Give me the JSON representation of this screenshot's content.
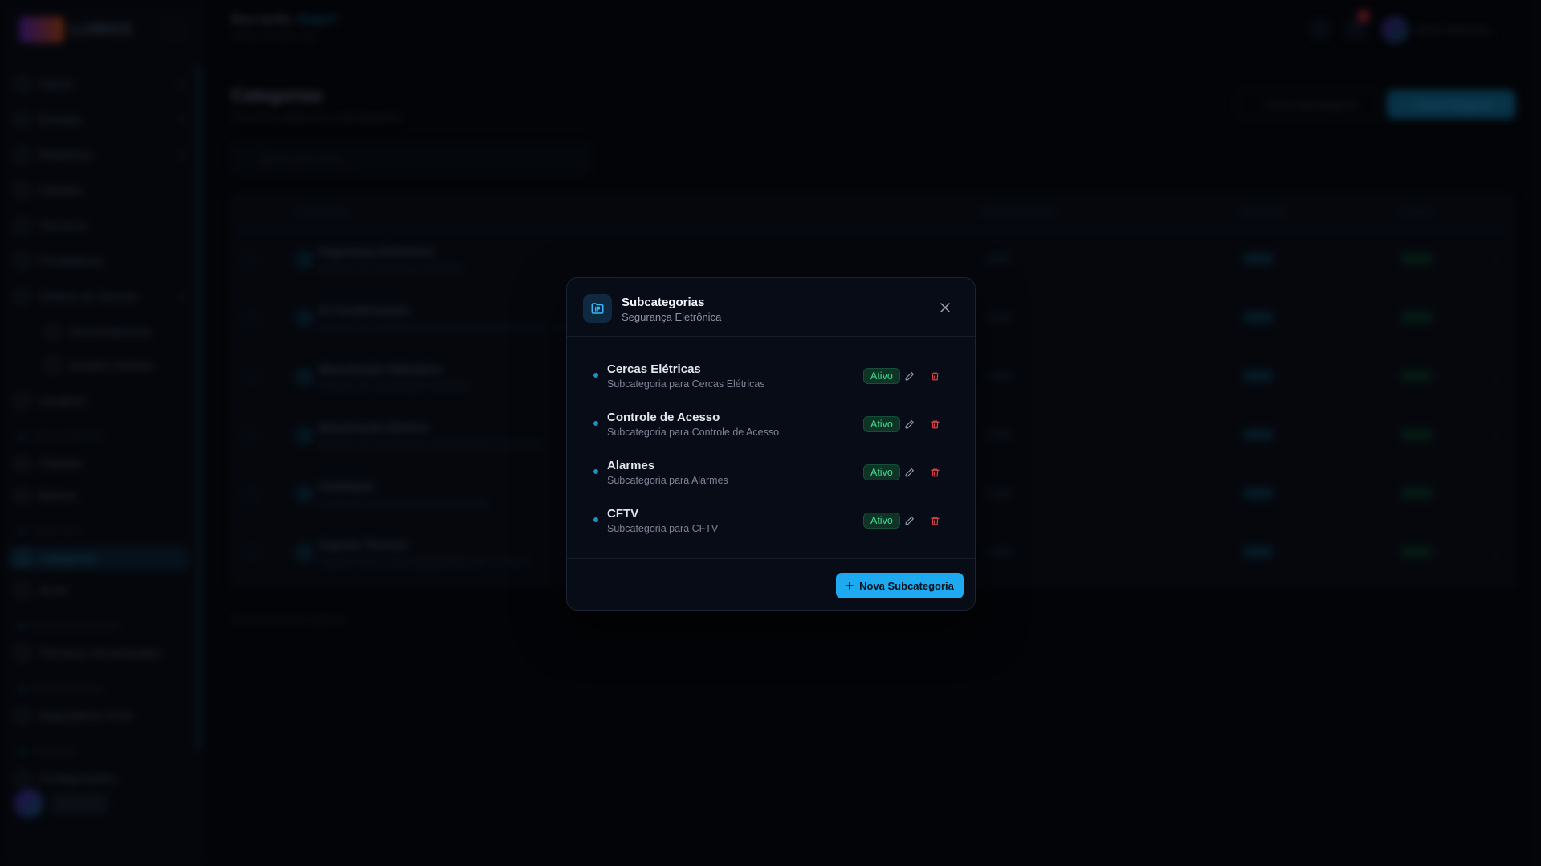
{
  "background": {
    "brand": "LUMOS",
    "greeting": {
      "prefix": "Boa tarde,",
      "name": "Super!",
      "sub": "Tenha um ótimo dia"
    },
    "nav": [
      {
        "label": "Painel",
        "chevron": true
      },
      {
        "label": "Entrada",
        "chevron": true
      },
      {
        "label": "Relatórios",
        "chevron": true
      },
      {
        "label": "Clientes",
        "chevron": false
      },
      {
        "label": "Técnicos",
        "chevron": false
      },
      {
        "label": "Prestadores",
        "chevron": false
      },
      {
        "label": "Ordens de Serviço",
        "chevron": true
      },
      {
        "label": "Gerenciamento",
        "sub": true
      },
      {
        "label": "Quadro Kanban",
        "sub": true
      },
      {
        "label": "Usuários",
        "chevron": false
      }
    ],
    "sections": [
      "LOCALIZAÇÃO",
      "SERVIÇOS",
      "ESPECIALIDADES",
      "DISPOSITIVOS",
      "SISTEMA"
    ],
    "section_items": {
      "loc": [
        "Cidades",
        "Bairros"
      ],
      "serv": [
        "Categorias",
        "SLAs"
      ],
      "esp": [
        "Técnicos Terceirizados"
      ],
      "disp": [
        "Dispositivos FCM"
      ],
      "sys": [
        "Configurações"
      ]
    },
    "page": {
      "title": "Categorias",
      "subtitle": "Gerencie categorias e subcategorias",
      "btn_ghost": "+ Nova Subcategoria",
      "btn_primary": "+ Nova Categoria",
      "search_placeholder": "Buscar por nome...",
      "headers": [
        "CATEGORIA",
        "SUBCATEGORIAS",
        "SERVIÇOS",
        "STATUS"
      ],
      "rows": [
        {
          "name": "Segurança Eletrônica",
          "desc": "Serviços de segurança eletrônica"
        },
        {
          "name": "Ar Condicionado",
          "desc": "Serviços de instalação e manutenção de sistemas de climatização"
        },
        {
          "name": "Manutenção Hidráulica",
          "desc": "Serviços de manutenção hidráulica"
        },
        {
          "name": "Manutenção Elétrica",
          "desc": "Serviços de manutenção elétrica predial e industrial"
        },
        {
          "name": "Instalação",
          "desc": "Instalação de equipamentos e sistemas"
        },
        {
          "name": "Suporte Técnico",
          "desc": "Suporte técnico para equipamentos de TI e redes"
        }
      ],
      "pager": "Mostrando 6 de 6 registros"
    }
  },
  "modal": {
    "title": "Subcategorias",
    "subtitle": "Segurança Eletrônica",
    "items": [
      {
        "name": "Cercas Elétricas",
        "desc": "Subcategoria para Cercas Elétricas",
        "status": "Ativo"
      },
      {
        "name": "Controle de Acesso",
        "desc": "Subcategoria para Controle de Acesso",
        "status": "Ativo"
      },
      {
        "name": "Alarmes",
        "desc": "Subcategoria para Alarmes",
        "status": "Ativo"
      },
      {
        "name": "CFTV",
        "desc": "Subcategoria para CFTV",
        "status": "Ativo"
      }
    ],
    "new_button": "Nova Subcategoria"
  },
  "colors": {
    "accent": "#1eaaf1",
    "active_badge_text": "#3ddc91",
    "delete_icon": "#e5484d",
    "modal_bg": "#070c17"
  }
}
